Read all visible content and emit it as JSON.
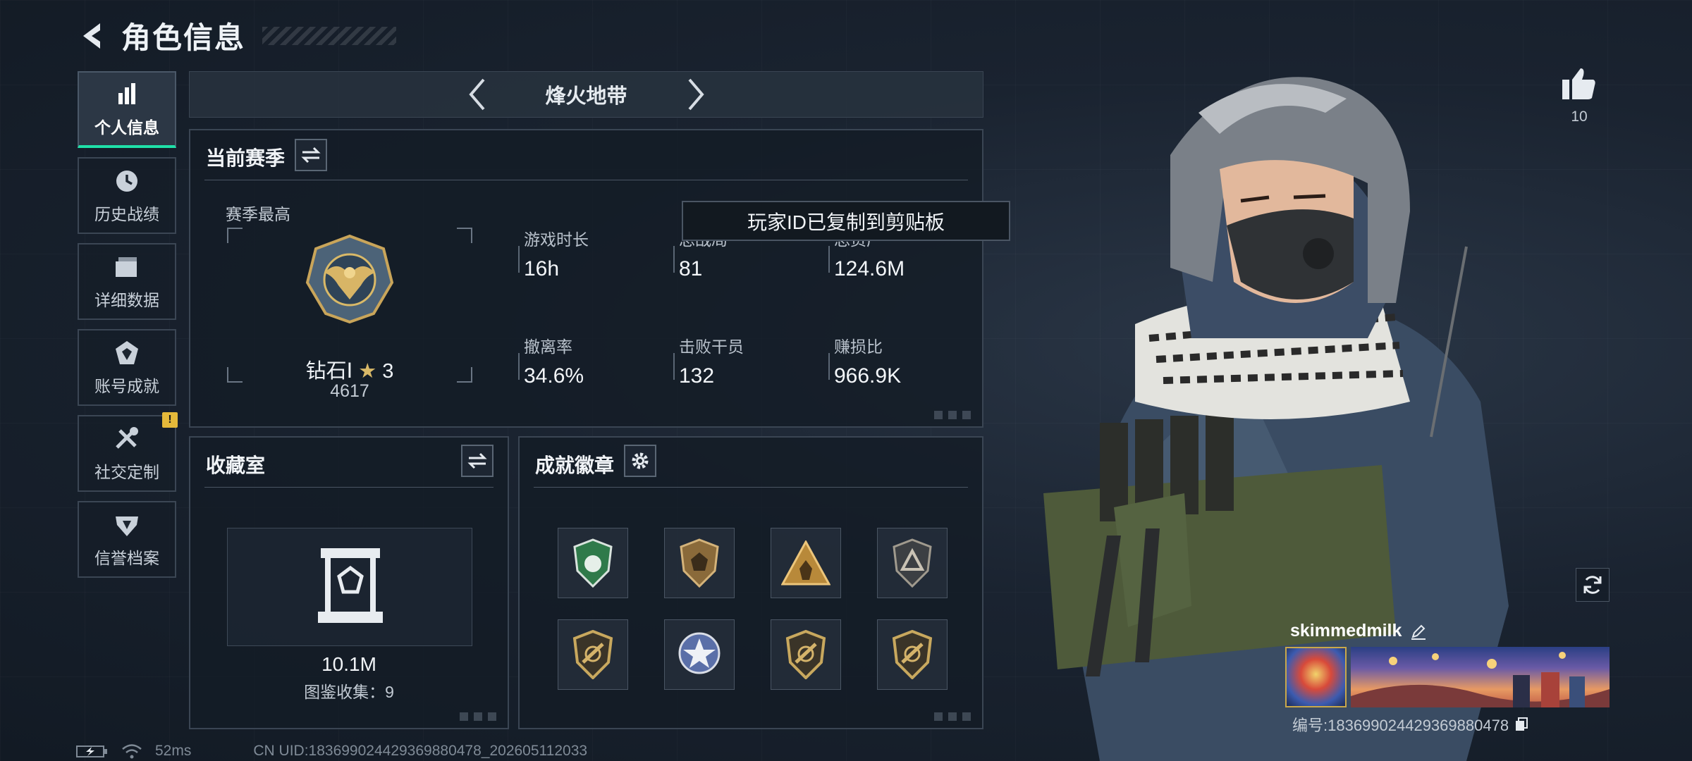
{
  "header": {
    "title": "角色信息"
  },
  "sidebar": {
    "items": [
      {
        "label": "个人信息",
        "icon": "bar-chart-icon",
        "active": true
      },
      {
        "label": "历史战绩",
        "icon": "history-clock-icon"
      },
      {
        "label": "详细数据",
        "icon": "folder-icon"
      },
      {
        "label": "账号成就",
        "icon": "achievement-icon"
      },
      {
        "label": "社交定制",
        "icon": "tools-icon",
        "badge": "!"
      },
      {
        "label": "信誉档案",
        "icon": "reputation-icon"
      }
    ]
  },
  "mode": {
    "name": "烽火地带"
  },
  "season": {
    "title": "当前赛季",
    "best_label": "赛季最高",
    "rank_name": "钻石Ⅰ",
    "rank_stars": "3",
    "rank_score": "4617",
    "stats": [
      {
        "key": "游戏时长",
        "value": "16h"
      },
      {
        "key": "总战局",
        "value": "81"
      },
      {
        "key": "总资产",
        "value": "124.6M"
      },
      {
        "key": "撤离率",
        "value": "34.6%"
      },
      {
        "key": "击败干员",
        "value": "132"
      },
      {
        "key": "赚损比",
        "value": "966.9K"
      }
    ]
  },
  "toast": {
    "text": "玩家ID已复制到剪贴板"
  },
  "collection": {
    "title": "收藏室",
    "value": "10.1M",
    "count": "图鉴收集：9"
  },
  "badges": {
    "title": "成就徽章",
    "items": [
      {
        "icon": "green-shield-badge-icon",
        "color": "#2f7a4a"
      },
      {
        "icon": "bronze-shield-badge-icon",
        "color": "#8a6a3a"
      },
      {
        "icon": "gold-triangle-badge-icon",
        "color": "#b8893a"
      },
      {
        "icon": "grey-shield-triangle-badge-icon",
        "color": "#6a6e72"
      },
      {
        "icon": "gold-rifle-shield-badge-icon",
        "color": "#b0934e"
      },
      {
        "icon": "star-medal-badge-icon",
        "color": "#5a6fa8"
      },
      {
        "icon": "gold-rifle-shield-badge-icon",
        "color": "#b0934e"
      },
      {
        "icon": "gold-rifle-shield-badge-icon",
        "color": "#b0934e"
      }
    ]
  },
  "profile": {
    "likes": "10",
    "name": "skimmedmilk",
    "id_label": "编号:1836990244293698804​78",
    "id_clean": "编号:183699024429369880478"
  },
  "footer": {
    "ping": "52ms",
    "uid": "CN UID:183699024429369880478_202605112033"
  },
  "colors": {
    "accent": "#1fe0a8",
    "warning": "#e5b93a"
  }
}
